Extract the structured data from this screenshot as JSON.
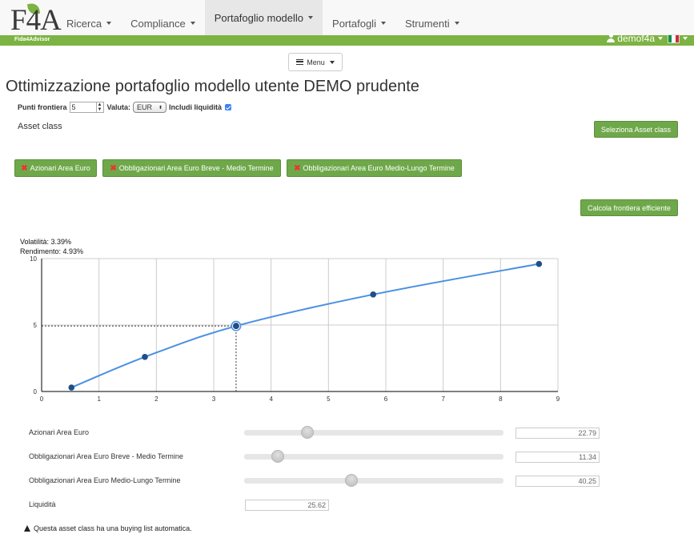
{
  "brand": {
    "logo_text": "F4A",
    "sub": "Fida4Advisor"
  },
  "nav": [
    {
      "label": "Ricerca"
    },
    {
      "label": "Compliance"
    },
    {
      "label": "Portafoglio modello"
    },
    {
      "label": "Portafogli"
    },
    {
      "label": "Strumenti"
    }
  ],
  "user": {
    "name": "demof4a",
    "flag_colors": [
      "#009246",
      "#ffffff",
      "#ce2b37"
    ]
  },
  "menu_button": "Menu",
  "page_title": "Ottimizzazione portafoglio modello utente DEMO prudente",
  "params": {
    "punti_label": "Punti frontiera",
    "punti_value": "5",
    "valuta_label": "Valuta:",
    "valuta_value": "EUR",
    "liquidita_label": "Includi liquidità",
    "liquidita_checked": true
  },
  "asset_class_label": "Asset class",
  "select_asset_button": "Seleziona Asset class",
  "chips": [
    {
      "label": "Azionari Area Euro"
    },
    {
      "label": "Obbligazionari Area Euro Breve - Medio Termine"
    },
    {
      "label": "Obbligazionari Area Euro Medio-Lungo Termine"
    }
  ],
  "compute_button": "Calcola frontiera efficiente",
  "info": {
    "volatility": "Volatilità: 3.39%",
    "return": "Rendimento: 4.93%"
  },
  "chart_data": {
    "type": "line",
    "xlim": [
      0,
      9
    ],
    "ylim": [
      0,
      10
    ],
    "x_ticks": [
      "0",
      "1",
      "2",
      "3",
      "4",
      "5",
      "6",
      "7",
      "8",
      "9"
    ],
    "y_ticks": [
      "0",
      "5",
      "10"
    ],
    "grid": true,
    "series": [
      {
        "color": "#4a90e2",
        "points": [
          {
            "x": 0.52,
            "y": 0.3
          },
          {
            "x": 1.8,
            "y": 2.6
          },
          {
            "x": 3.39,
            "y": 4.93
          },
          {
            "x": 5.78,
            "y": 7.3
          },
          {
            "x": 8.67,
            "y": 9.6
          }
        ]
      }
    ],
    "selected": {
      "x": 3.39,
      "y": 4.93
    }
  },
  "allocations": [
    {
      "label": "Azionari Area Euro",
      "value": "22.79",
      "slider": 0.2279
    },
    {
      "label": "Obbligazionari Area Euro Breve - Medio Termine",
      "value": "11.34",
      "slider": 0.1134
    },
    {
      "label": "Obbligazionari Area Euro Medio-Lungo Termine",
      "value": "40.25",
      "slider": 0.4025
    }
  ],
  "liquidity": {
    "label": "Liquidità",
    "value": "25.62"
  },
  "footer_note": "Questa asset class ha una buying list automatica."
}
